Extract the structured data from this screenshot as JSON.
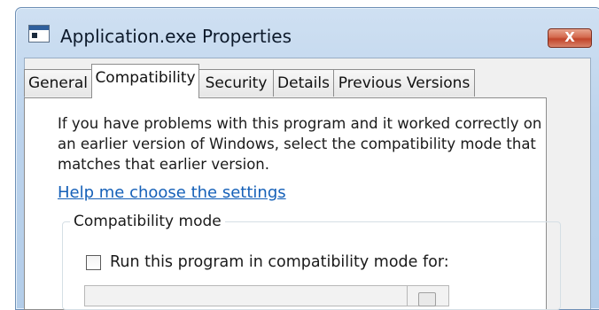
{
  "window": {
    "title": "Application.exe Properties",
    "close_label": "X"
  },
  "tabs": [
    {
      "label": "General",
      "active": false
    },
    {
      "label": "Compatibility",
      "active": true
    },
    {
      "label": "Security",
      "active": false
    },
    {
      "label": "Details",
      "active": false
    },
    {
      "label": "Previous Versions",
      "active": false
    }
  ],
  "compatibility": {
    "description_lines": [
      "If you have problems with this program and it worked correctly on",
      "an earlier version of Windows, select the compatibility mode that",
      "matches that earlier version."
    ],
    "help_link": "Help me choose the settings",
    "group_label": "Compatibility mode",
    "checkbox_label": "Run this program in compatibility mode for:",
    "checkbox_checked": false,
    "combo_value": ""
  },
  "colors": {
    "link": "#1560b8",
    "close_button": "#c2452a",
    "title_bar": "#bcd3ec"
  },
  "icons": {
    "window_icon": "application-window-icon",
    "close_icon": "close-icon",
    "dropdown_icon": "chevron-down-icon"
  }
}
